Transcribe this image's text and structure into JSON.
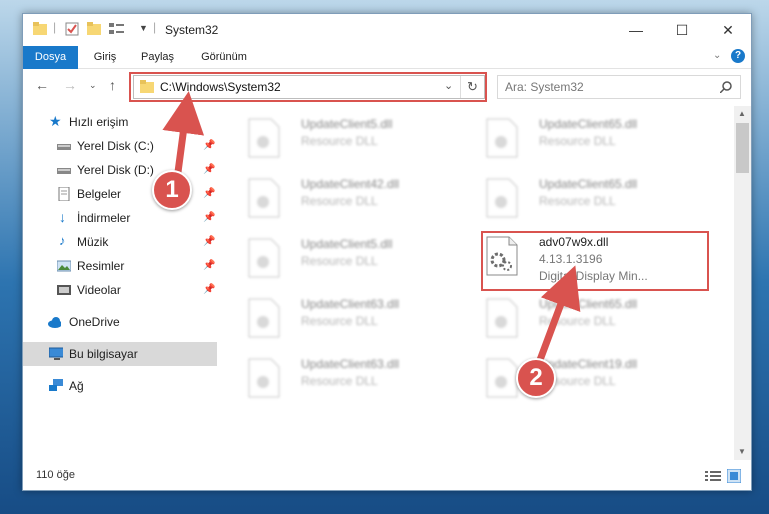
{
  "window": {
    "title": "System32",
    "controls": {
      "minimize": "—",
      "maximize": "☐",
      "close": "✕"
    }
  },
  "ribbon": {
    "tabs": [
      "Dosya",
      "Giriş",
      "Paylaş",
      "Görünüm"
    ]
  },
  "nav": {
    "address": "C:\\Windows\\System32",
    "search_placeholder": "Ara: System32"
  },
  "sidebar": {
    "quick_access": "Hızlı erişim",
    "items": [
      {
        "label": "Yerel Disk (C:)",
        "icon": "drive-icon"
      },
      {
        "label": "Yerel Disk (D:)",
        "icon": "drive-icon"
      },
      {
        "label": "Belgeler",
        "icon": "documents-icon"
      },
      {
        "label": "İndirmeler",
        "icon": "downloads-icon"
      },
      {
        "label": "Müzik",
        "icon": "music-icon"
      },
      {
        "label": "Resimler",
        "icon": "pictures-icon"
      },
      {
        "label": "Videolar",
        "icon": "videos-icon"
      }
    ],
    "onedrive": "OneDrive",
    "this_pc": "Bu bilgisayar",
    "network": "Ağ"
  },
  "files": [
    {
      "name": "UpdateClient5.dll",
      "type": "Resource DLL"
    },
    {
      "name": "UpdateClient65.dll",
      "type": "Resource DLL"
    },
    {
      "name": "UpdateClient42.dll",
      "type": "Resource DLL"
    },
    {
      "name": "UpdateClient65.dll",
      "type": "Resource DLL"
    },
    {
      "name": "UpdateClient5.dll",
      "type": "Resource DLL"
    },
    {
      "name": "adv07w9x.dll",
      "version": "4.13.1.3196",
      "description": "Digital Display Min..."
    },
    {
      "name": "UpdateClient63.dll",
      "type": "Resource DLL"
    },
    {
      "name": "UpdateClient65.dll",
      "type": "Resource DLL"
    },
    {
      "name": "UpdateClient63.dll",
      "type": "Resource DLL"
    },
    {
      "name": "UpdateClient19.dll",
      "type": "Resource DLL"
    }
  ],
  "status": {
    "count": "110 öğe"
  },
  "annotations": {
    "step1": "1",
    "step2": "2"
  },
  "colors": {
    "accent": "#1979ca",
    "highlight": "#d9534f"
  }
}
